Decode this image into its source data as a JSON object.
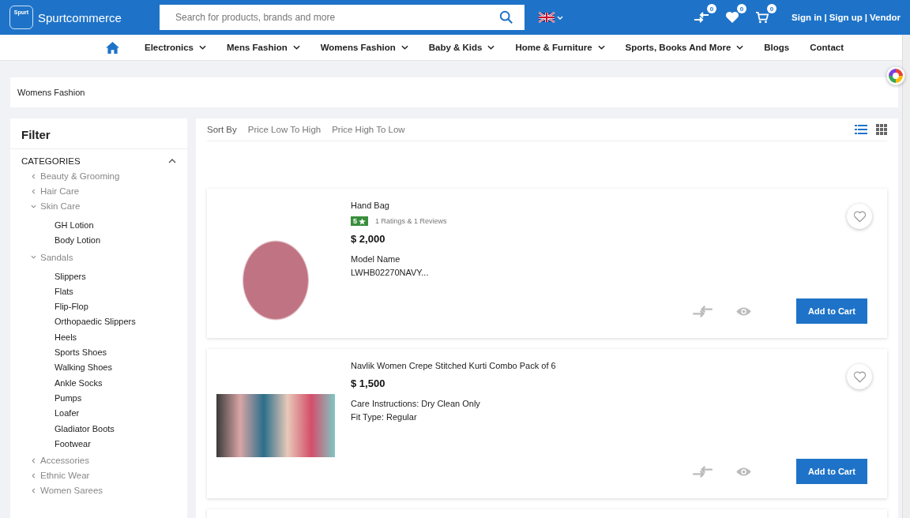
{
  "header": {
    "logo_badge": "Spurt",
    "brand": "Spurtcommerce",
    "search": {
      "placeholder": "Search for products, brands and more"
    },
    "icons": [
      {
        "kind": "compare",
        "count": "0"
      },
      {
        "kind": "wishlist",
        "count": "0"
      },
      {
        "kind": "cart",
        "count": "0"
      }
    ],
    "auth_links": [
      "Sign in",
      "Sign up",
      "Vendor"
    ],
    "separator": "|"
  },
  "nav": [
    {
      "label": "Electronics",
      "has_dropdown": true
    },
    {
      "label": "Mens Fashion",
      "has_dropdown": true
    },
    {
      "label": "Womens Fashion",
      "has_dropdown": true
    },
    {
      "label": "Baby & Kids",
      "has_dropdown": true
    },
    {
      "label": "Home & Furniture",
      "has_dropdown": true
    },
    {
      "label": "Sports, Books And More",
      "has_dropdown": true
    },
    {
      "label": "Blogs",
      "has_dropdown": false
    },
    {
      "label": "Contact",
      "has_dropdown": false
    }
  ],
  "breadcrumb": "Womens Fashion",
  "filter": {
    "title": "Filter",
    "section": "CATEGORIES",
    "section_expanded": true,
    "categories": [
      {
        "label": "Beauty & Grooming",
        "expanded": false
      },
      {
        "label": "Hair Care",
        "expanded": false
      },
      {
        "label": "Skin Care",
        "expanded": true,
        "children": [
          {
            "label": "GH Lotion"
          },
          {
            "label": "Body Lotion"
          }
        ]
      },
      {
        "label": "Sandals",
        "expanded": true,
        "children": [
          {
            "label": "Slippers"
          },
          {
            "label": "Flats"
          },
          {
            "label": "Flip-Flop"
          },
          {
            "label": "Orthopaedic Slippers"
          },
          {
            "label": "Heels"
          },
          {
            "label": "Sports Shoes"
          },
          {
            "label": "Walking Shoes"
          },
          {
            "label": "Ankle Socks"
          },
          {
            "label": "Pumps"
          },
          {
            "label": "Loafer"
          },
          {
            "label": "Gladiator Boots"
          },
          {
            "label": "Footwear"
          }
        ]
      },
      {
        "label": "Accessories",
        "expanded": false
      },
      {
        "label": "Ethnic Wear",
        "expanded": false
      },
      {
        "label": "Women Sarees",
        "expanded": false
      }
    ]
  },
  "sort": {
    "label": "Sort By",
    "options": [
      {
        "label": "Price Low To High",
        "selected": false
      },
      {
        "label": "Price High To Low",
        "selected": false
      }
    ]
  },
  "views": [
    {
      "kind": "list",
      "selected": true
    },
    {
      "kind": "grid",
      "selected": false
    }
  ],
  "products": [
    {
      "name": "Hand Bag",
      "rating": "5",
      "reviews": "1 Ratings & 1 Reviews",
      "price": "$ 2,000",
      "details": [
        "Model Name",
        "LWHB02270NAVY..."
      ],
      "button": "Add to Cart"
    },
    {
      "name": "Navlik Women Crepe Stitched Kurti Combo Pack of 6",
      "price": "$ 1,500",
      "details": [
        "Care Instructions: Dry Clean Only",
        "Fit Type: Regular"
      ],
      "button": "Add to Cart"
    }
  ]
}
